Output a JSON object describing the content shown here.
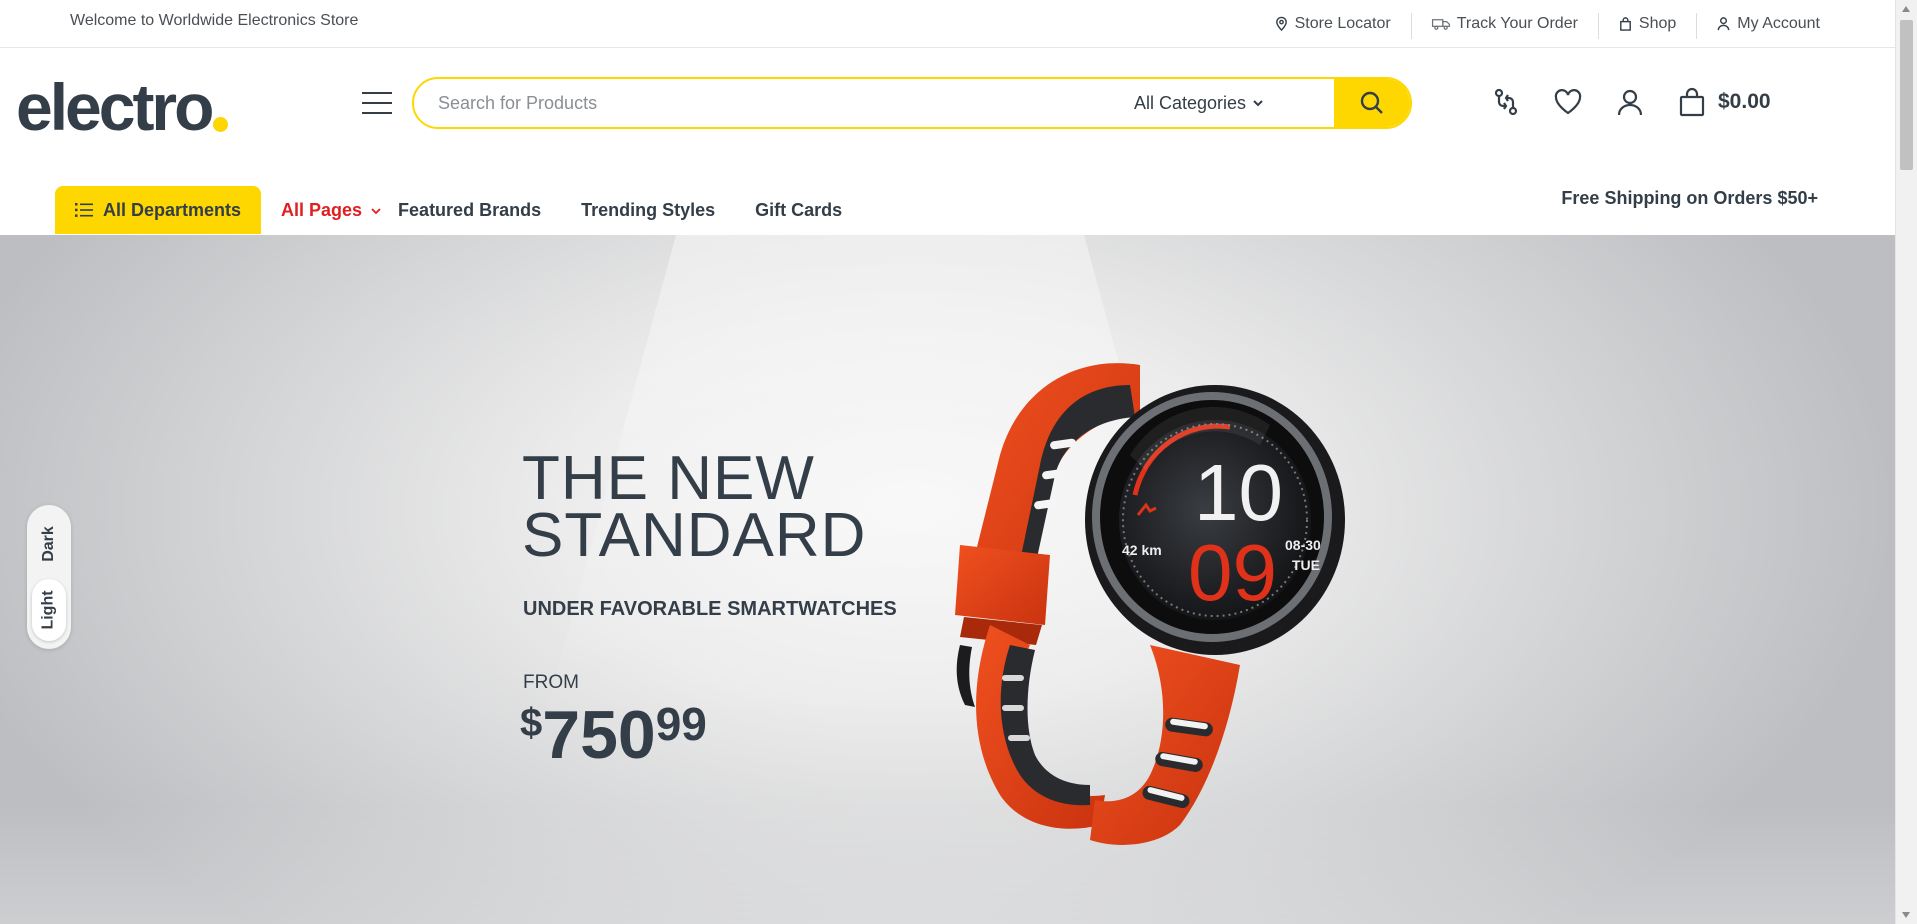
{
  "topbar": {
    "welcome": "Welcome to Worldwide Electronics Store",
    "links": {
      "store_locator": "Store Locator",
      "track_order": "Track Your Order",
      "shop": "Shop",
      "my_account": "My Account"
    }
  },
  "header": {
    "logo_text": "electro",
    "search": {
      "placeholder": "Search for Products",
      "category": "All Categories"
    },
    "cart_total": "$0.00",
    "icons": [
      "compare-icon",
      "heart-icon",
      "user-icon",
      "cart-icon",
      "search-icon",
      "menu-icon"
    ]
  },
  "nav": {
    "all_departments": "All Departments",
    "links": [
      "All Pages",
      "Featured Brands",
      "Trending Styles",
      "Gift Cards"
    ],
    "free_shipping": "Free Shipping on Orders $50+"
  },
  "hero": {
    "title_line1": "THE NEW",
    "title_line2": "STANDARD",
    "subtitle": "UNDER FAVORABLE SMARTWATCHES",
    "from": "FROM",
    "currency": "$",
    "price_int": "750",
    "price_dec": "99",
    "watch_display": {
      "hours": "10",
      "minutes": "09",
      "distance": "42 km",
      "date": "08-30",
      "day": "TUE"
    }
  },
  "theme_toggle": {
    "dark": "Dark",
    "light": "Light",
    "selected": "Light"
  },
  "colors": {
    "accent": "#fed700",
    "text": "#333e48",
    "active_link": "#e02020",
    "watch_strap": "#e8431b"
  }
}
